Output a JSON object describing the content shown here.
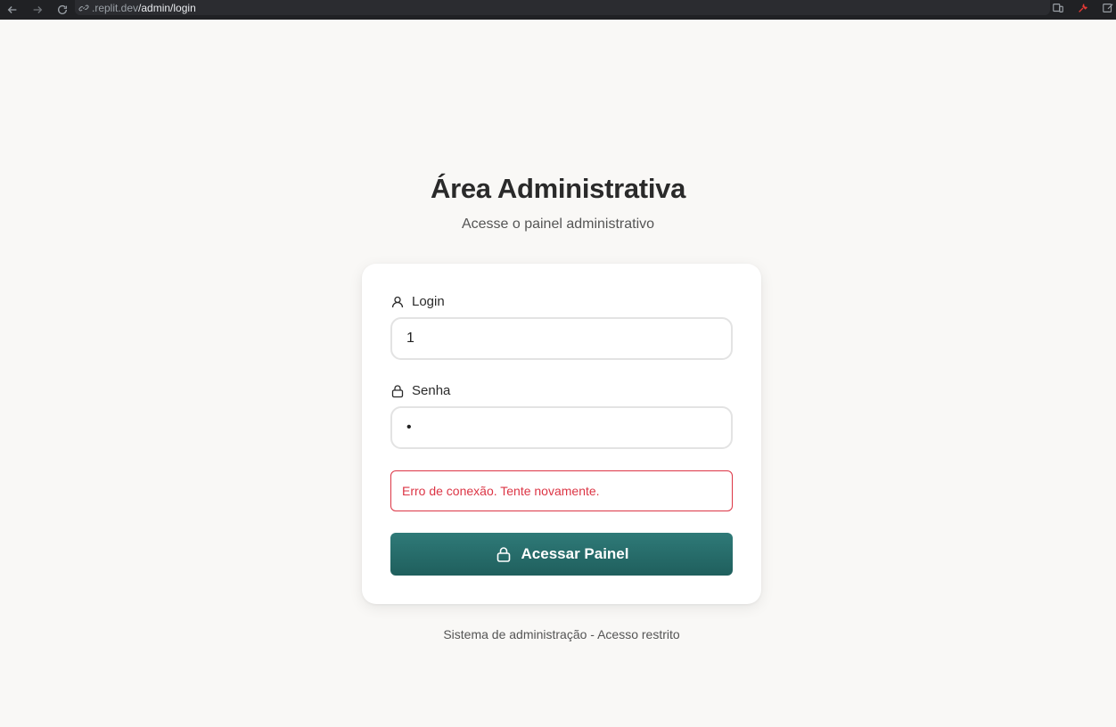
{
  "browser": {
    "url_host": ".replit.dev",
    "url_path": "/admin/login"
  },
  "header": {
    "title": "Área Administrativa",
    "subtitle": "Acesse o painel administrativo"
  },
  "form": {
    "login_label": "Login",
    "login_value": "1",
    "password_label": "Senha",
    "password_value": "•",
    "error_message": "Erro de conexão. Tente novamente.",
    "submit_label": "Acessar Painel"
  },
  "footer": {
    "text": "Sistema de administração - Acesso restrito"
  },
  "colors": {
    "accent": "#2f7a78",
    "error": "#dc3545",
    "background": "#f9f8f6"
  }
}
